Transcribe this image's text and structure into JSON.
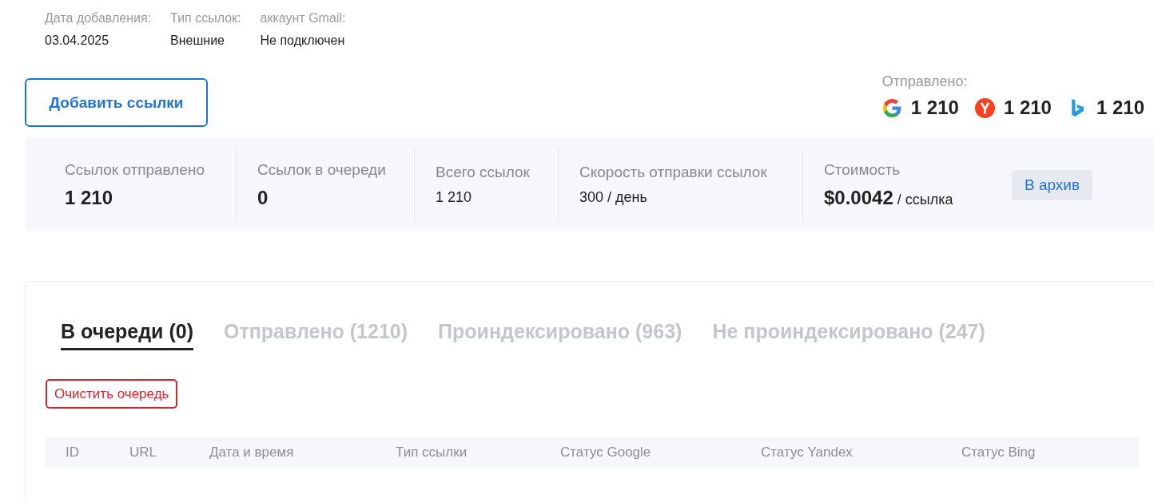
{
  "info": [
    {
      "label": "Дата добавления:",
      "value": "03.04.2025"
    },
    {
      "label": "Тип ссылок:",
      "value": "Внешние"
    },
    {
      "label": "аккаунт Gmail:",
      "value": "Не подключен"
    }
  ],
  "add_button": "Добавить ссылки",
  "sent": {
    "label": "Отправлено:",
    "engines": [
      {
        "kind": "google",
        "count": "1 210"
      },
      {
        "kind": "yandex",
        "count": "1 210"
      },
      {
        "kind": "bing",
        "count": "1 210"
      }
    ]
  },
  "stats": [
    {
      "label": "Ссылок отправлено",
      "value": "1 210",
      "kind": "big"
    },
    {
      "label": "Ссылок в очереди",
      "value": "0",
      "kind": "big"
    },
    {
      "label": "Всего ссылок",
      "value": "1 210",
      "kind": "plain"
    },
    {
      "label": "Скорость отправки ссылок",
      "value": "300 / день",
      "kind": "plain"
    },
    {
      "label": "Стоимость",
      "value": "$0.0042",
      "unit": "/ ссылка",
      "kind": "price"
    }
  ],
  "archive_button": "В архив",
  "tabs": [
    {
      "label": "В очереди (0)",
      "selected": true
    },
    {
      "label": "Отправлено (1210)",
      "selected": false
    },
    {
      "label": "Проиндексировано (963)",
      "selected": false
    },
    {
      "label": "Не проиндексировано (247)",
      "selected": false
    }
  ],
  "clear_button": "Очистить очередь",
  "table": {
    "columns": [
      "ID",
      "URL",
      "Дата и время",
      "Тип ссылки",
      "Статус Google",
      "Статус Yandex",
      "Статус Bing"
    ]
  }
}
